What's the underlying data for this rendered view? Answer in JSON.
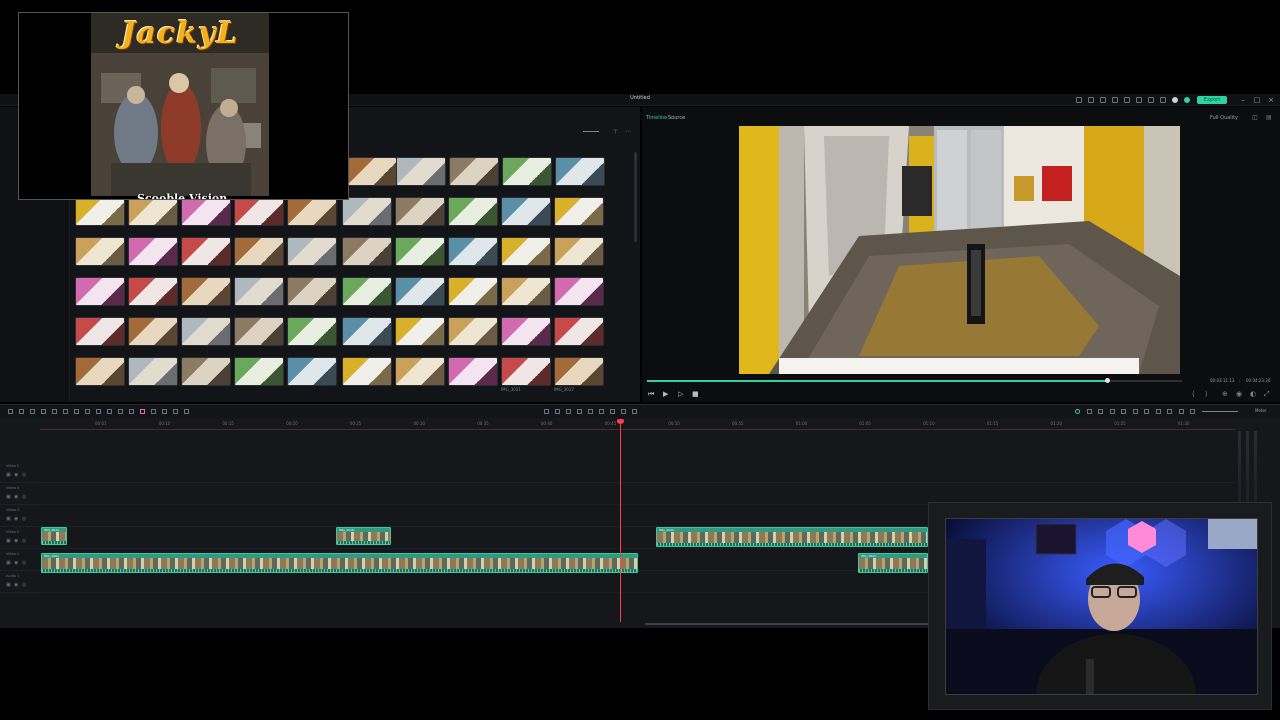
{
  "window": {
    "title": "Untitled",
    "export_label": "Export",
    "controls": [
      "–",
      "□",
      "×"
    ]
  },
  "preview": {
    "tabs": [
      "Timeline",
      "Source"
    ],
    "quality": "Full Quality",
    "time_current": "00:03:11:13",
    "time_total": "00:04:23:20",
    "progress": 0.86,
    "controls": [
      "⏮",
      "▶",
      "▷",
      "■"
    ]
  },
  "media": {
    "clip_labels": [
      "IMG_3021",
      "IMG_3017"
    ]
  },
  "timeline": {
    "ruler_labels": [
      "00:01",
      "00:10",
      "00:15",
      "00:20",
      "00:25",
      "00:30",
      "00:35",
      "00:40",
      "00:45",
      "00:50",
      "00:55",
      "01:00",
      "01:05",
      "01:10",
      "01:15",
      "01:20",
      "01:25",
      "01:30"
    ],
    "tracks": [
      {
        "name": "Video 5"
      },
      {
        "name": "Video 4"
      },
      {
        "name": "Video 3"
      },
      {
        "name": "Video 2"
      },
      {
        "name": "Video 1"
      },
      {
        "name": "Audio 1"
      }
    ],
    "clips": [
      {
        "track": 3,
        "label": "IMG_3014"
      },
      {
        "track": 3,
        "label": "IMG_3018"
      },
      {
        "track": 3,
        "label": "IMG_3021"
      },
      {
        "track": 4,
        "label": "IMG_3001"
      },
      {
        "track": 4,
        "label": "IMG_3020"
      }
    ],
    "zoom_label": "Meter"
  },
  "overlay": {
    "album_title": "JackyL",
    "caption": "Scooble Vision"
  },
  "icons": [
    "search-icon",
    "gear-icon",
    "export-icon",
    "play-icon",
    "stop-icon",
    "undo-icon",
    "redo-icon",
    "scissors-icon"
  ],
  "colors": {
    "accent": "#2fd3a3",
    "playhead": "#ff3b4a",
    "clip": "#1f6f5c"
  }
}
